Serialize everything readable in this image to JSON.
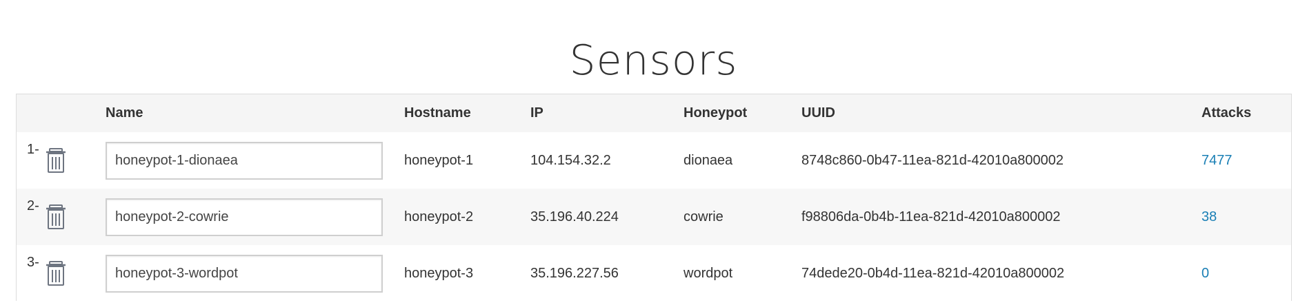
{
  "page": {
    "title": "Sensors"
  },
  "table": {
    "headers": {
      "index": "",
      "name": "Name",
      "hostname": "Hostname",
      "ip": "IP",
      "honeypot": "Honeypot",
      "uuid": "UUID",
      "attacks": "Attacks"
    },
    "rows": [
      {
        "index": "1-",
        "name": "honeypot-1-dionaea",
        "hostname": "honeypot-1",
        "ip": "104.154.32.2",
        "honeypot": "dionaea",
        "uuid": "8748c860-0b47-11ea-821d-42010a800002",
        "attacks": "7477"
      },
      {
        "index": "2-",
        "name": "honeypot-2-cowrie",
        "hostname": "honeypot-2",
        "ip": "35.196.40.224",
        "honeypot": "cowrie",
        "uuid": "f98806da-0b4b-11ea-821d-42010a800002",
        "attacks": "38"
      },
      {
        "index": "3-",
        "name": "honeypot-3-wordpot",
        "hostname": "honeypot-3",
        "ip": "35.196.227.56",
        "honeypot": "wordpot",
        "uuid": "74dede20-0b4d-11ea-821d-42010a800002",
        "attacks": "0"
      }
    ]
  },
  "icons": {
    "delete": "trash-icon"
  },
  "colors": {
    "link": "#1a7fb5",
    "header_bg": "#f5f5f5",
    "stripe_bg": "#f7f7f7"
  }
}
